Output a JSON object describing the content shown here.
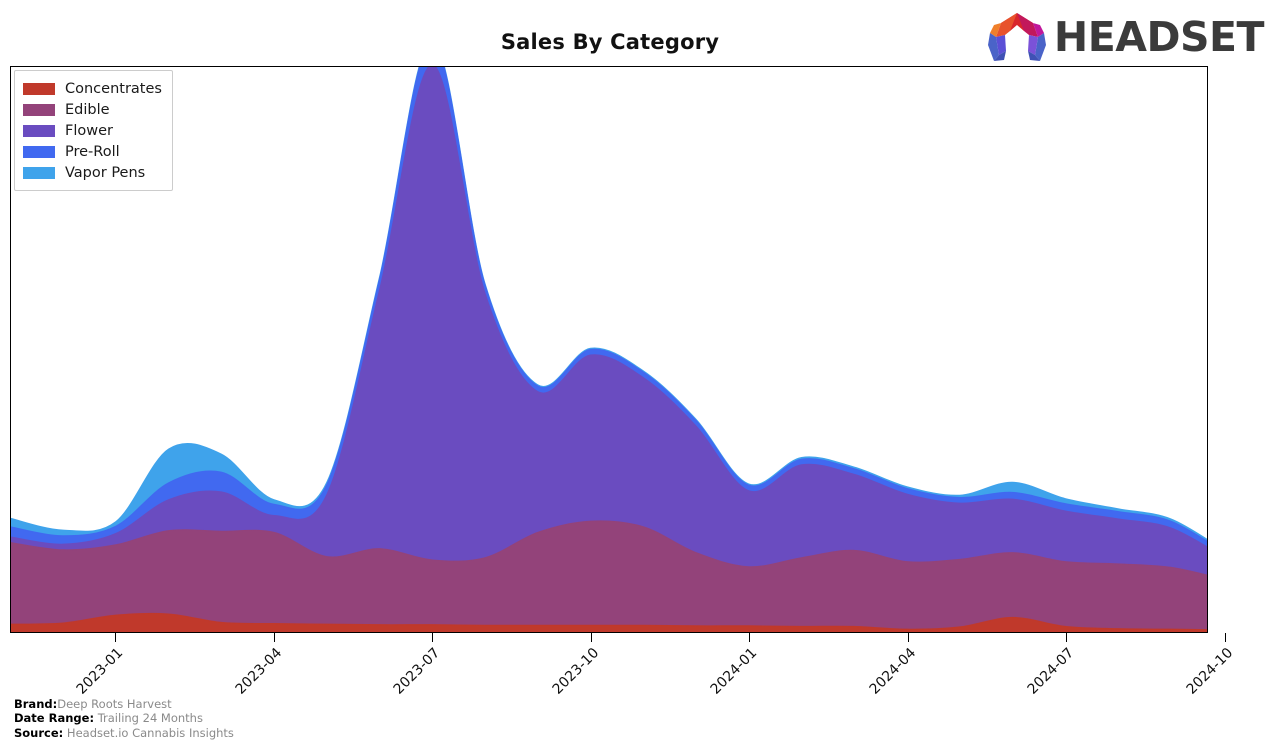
{
  "header": {
    "title": "Sales By Category",
    "logo_text": "HEADSET",
    "logo_colors": [
      "#F07F2A",
      "#D9262C",
      "#C2185B",
      "#C0179B",
      "#8E44D0",
      "#3F51B5",
      "#4A63C8"
    ]
  },
  "legend": {
    "position": "upper-left",
    "items": [
      {
        "label": "Concentrates",
        "color": "#C0392B"
      },
      {
        "label": "Edible",
        "color": "#93437A"
      },
      {
        "label": "Flower",
        "color": "#6A4CC0"
      },
      {
        "label": "Pre-Roll",
        "color": "#4169F0"
      },
      {
        "label": "Vapor Pens",
        "color": "#3FA3EB"
      }
    ]
  },
  "footer": {
    "lines": [
      {
        "key": "Brand:",
        "value": "Deep Roots Harvest"
      },
      {
        "key": "Date Range:",
        "value": "Trailing 24 Months"
      },
      {
        "key": "Source:",
        "value": "Headset.io Cannabis Insights"
      }
    ]
  },
  "chart_data": {
    "type": "area",
    "stacked": true,
    "smoothing": "spline",
    "title": "Sales By Category",
    "xlabel": "",
    "ylabel": "",
    "grid": false,
    "legend_position": "upper-left",
    "x": [
      "2022-11",
      "2022-12",
      "2023-01",
      "2023-02",
      "2023-03",
      "2023-04",
      "2023-05",
      "2023-06",
      "2023-07",
      "2023-08",
      "2023-09",
      "2023-10",
      "2023-11",
      "2023-12",
      "2024-01",
      "2024-02",
      "2024-03",
      "2024-04",
      "2024-05",
      "2024-06",
      "2024-07",
      "2024-08",
      "2024-09",
      "2024-10"
    ],
    "tick_labels": [
      "2023-01",
      "2023-04",
      "2023-07",
      "2023-10",
      "2024-01",
      "2024-04",
      "2024-07",
      "2024-10"
    ],
    "tick_x": [
      "2023-01",
      "2023-04",
      "2023-07",
      "2023-10",
      "2024-01",
      "2024-04",
      "2024-07",
      "2024-10"
    ],
    "ylim": [
      0,
      100
    ],
    "series": [
      {
        "name": "Concentrates",
        "color": "#C0392B",
        "values": [
          1.4,
          1.6,
          3.0,
          3.2,
          1.7,
          1.5,
          1.4,
          1.3,
          1.3,
          1.2,
          1.2,
          1.2,
          1.2,
          1.1,
          1.1,
          1.0,
          1.0,
          0.5,
          0.9,
          2.6,
          1.0,
          0.6,
          0.5,
          0.4
        ]
      },
      {
        "name": "Edible",
        "color": "#93437A",
        "values": [
          14.5,
          13.0,
          12.5,
          14.8,
          16.2,
          16.2,
          12.0,
          13.5,
          11.5,
          12.0,
          16.5,
          18.5,
          17.5,
          13.0,
          10.5,
          12.2,
          13.5,
          12.0,
          12.0,
          11.5,
          11.5,
          11.5,
          11.0,
          9.0
        ]
      },
      {
        "name": "Flower",
        "color": "#6A4CC0",
        "values": [
          1.0,
          1.0,
          2.0,
          5.5,
          7.0,
          3.0,
          11.0,
          46.0,
          88.0,
          47.0,
          25.0,
          29.5,
          26.5,
          22.5,
          13.5,
          16.5,
          13.5,
          12.0,
          10.0,
          9.5,
          9.0,
          8.0,
          7.0,
          4.0
        ]
      },
      {
        "name": "Pre-Roll",
        "color": "#4169F0",
        "values": [
          1.8,
          1.5,
          1.3,
          3.0,
          3.5,
          2.0,
          1.8,
          2.0,
          4.0,
          1.5,
          1.0,
          1.0,
          1.0,
          1.0,
          1.0,
          1.0,
          1.0,
          1.0,
          1.0,
          1.2,
          1.3,
          1.3,
          1.2,
          0.9
        ]
      },
      {
        "name": "Vapor Pens",
        "color": "#3FA3EB",
        "values": [
          1.5,
          1.0,
          0.8,
          6.0,
          3.2,
          0.8,
          0.4,
          0.3,
          0.3,
          0.2,
          0.2,
          0.2,
          0.2,
          0.2,
          0.2,
          0.3,
          0.3,
          0.3,
          0.4,
          1.8,
          0.9,
          0.5,
          0.4,
          0.3
        ]
      }
    ]
  }
}
